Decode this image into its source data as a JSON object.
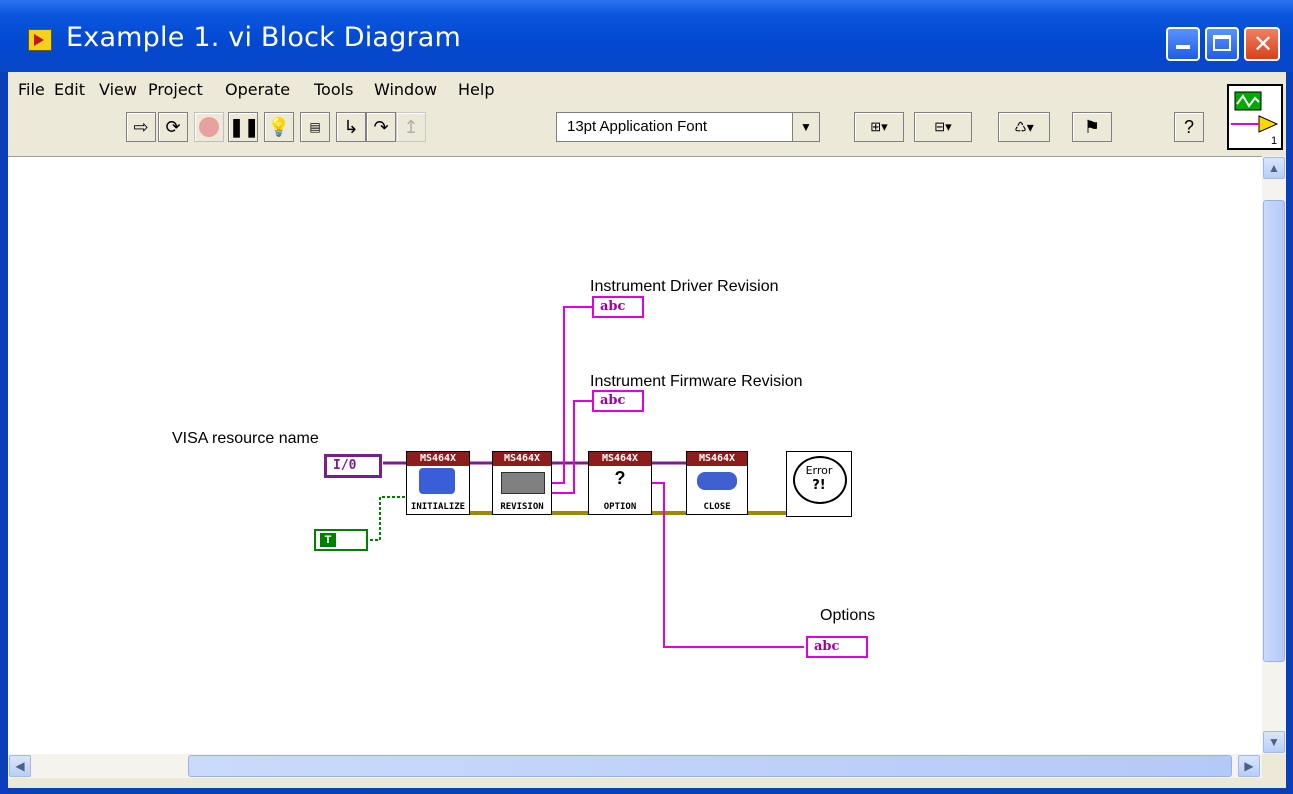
{
  "window": {
    "title": "Example 1. vi Block Diagram"
  },
  "menu": [
    "File",
    "Edit",
    "View",
    "Project",
    "Operate",
    "Tools",
    "Window",
    "Help"
  ],
  "toolbar": {
    "font": "13pt Application Font"
  },
  "diagram": {
    "labels": {
      "visa": "VISA resource name",
      "driver_rev": "Instrument Driver Revision",
      "firmware_rev": "Instrument Firmware Revision",
      "options": "Options"
    },
    "controls": {
      "visa_control": "I/0",
      "bool_control": "T"
    },
    "indicators": {
      "string_glyph": "abc"
    },
    "nodes": {
      "header": "MS464X",
      "initialize": "INITIALIZE",
      "revision": "REVISION",
      "option": "OPTION",
      "close": "CLOSE",
      "error": "Error",
      "error_glyph": "?!"
    }
  },
  "colors": {
    "title_bar": "#0a46c8",
    "wire_error": "#9a8a00",
    "wire_string": "#e000e0",
    "wire_visa": "#7a1e8e",
    "wire_bool": "#008000",
    "node_header": "#8b1d1d"
  }
}
